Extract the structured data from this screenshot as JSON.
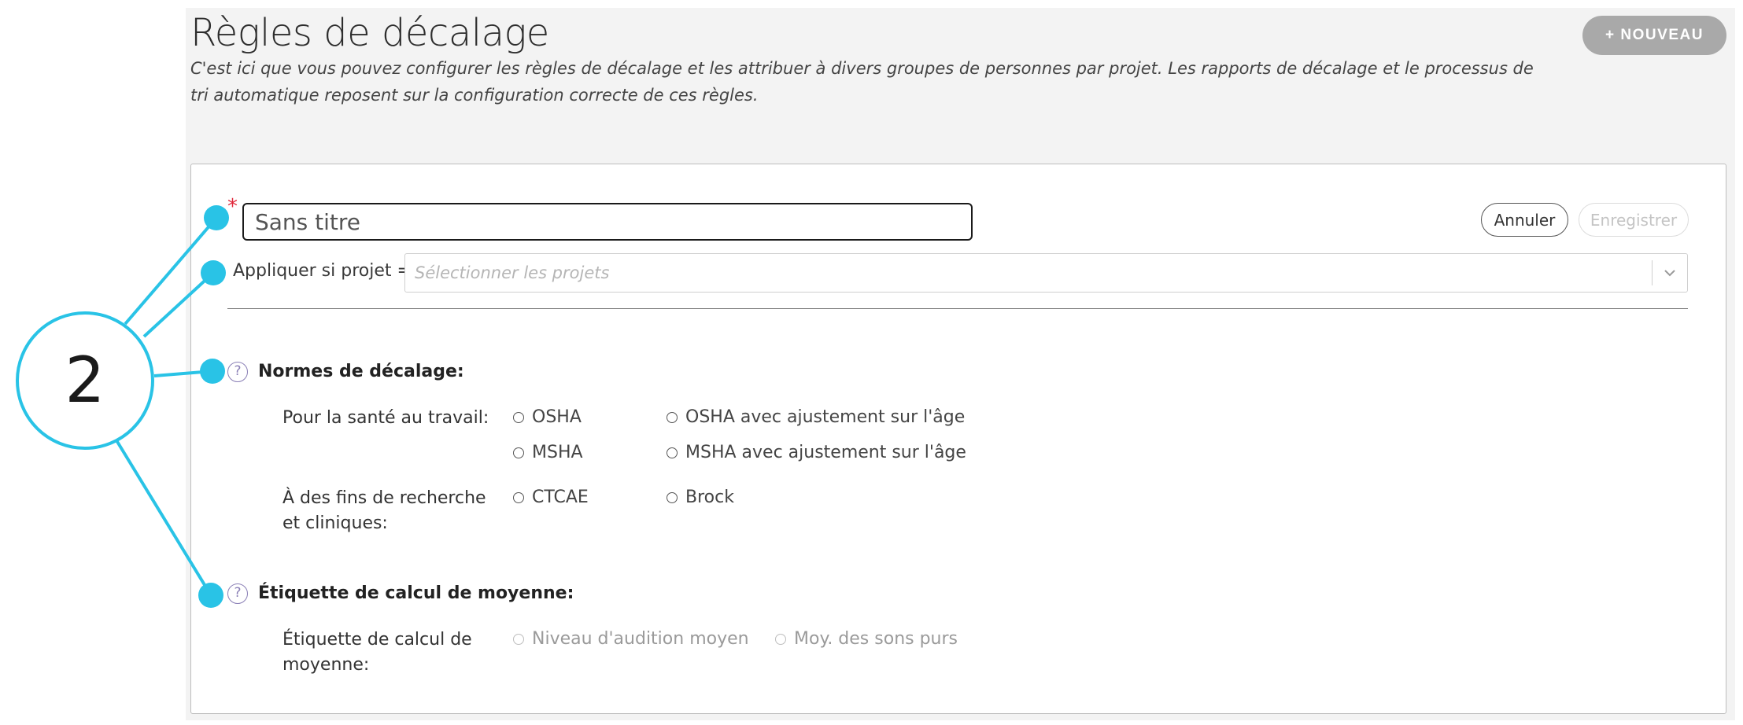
{
  "header": {
    "title": "Règles de décalage",
    "description": "C'est ici que vous pouvez configurer les règles de décalage et les attribuer à divers groupes de personnes par projet. Les rapports de décalage et le processus de tri automatique reposent sur la configuration correcte de ces règles.",
    "new_label": "+ NOUVEAU"
  },
  "form": {
    "required_marker": "*",
    "title_placeholder": "Sans titre",
    "cancel_label": "Annuler",
    "save_label": "Enregistrer",
    "project_label": "Appliquer si projet =",
    "project_placeholder": "Sélectionner les projets",
    "help_glyph": "?"
  },
  "shift_norms": {
    "heading": "Normes de décalage:",
    "occupational_label": "Pour la santé au travail:",
    "occupational_options": [
      "OSHA",
      "OSHA avec ajustement sur l'âge",
      "MSHA",
      "MSHA avec ajustement sur l'âge"
    ],
    "research_label": "À des fins de recherche et cliniques:",
    "research_options": [
      "CTCAE",
      "Brock"
    ]
  },
  "averaging": {
    "heading": "Étiquette de calcul de moyenne:",
    "row_label": "Étiquette de calcul de moyenne:",
    "options": [
      "Niveau d'audition moyen",
      "Moy. des sons purs"
    ]
  },
  "callout": {
    "number": "2",
    "color": "#29c3e6"
  },
  "colors": {
    "panel_bg": "#f3f3f3",
    "new_button_bg": "#a9a9a9",
    "required": "#e0283a",
    "help_icon": "#8a7fb6"
  }
}
